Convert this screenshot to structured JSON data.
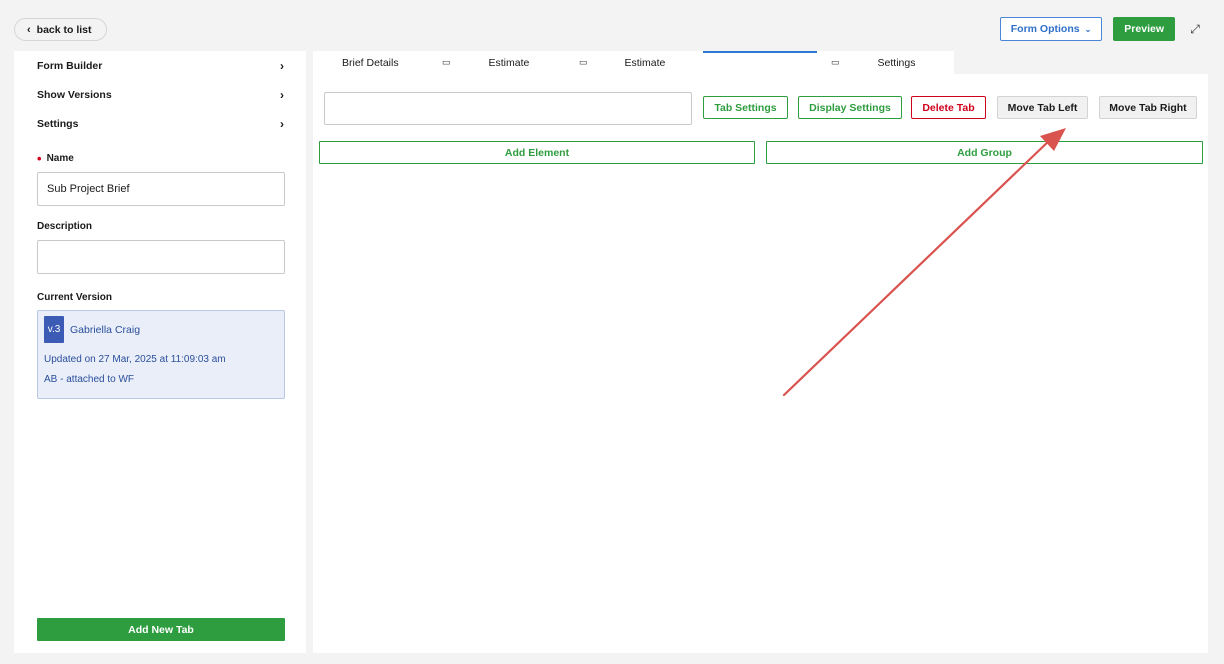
{
  "header": {
    "back_label": "back to list",
    "form_options_label": "Form Options",
    "preview_label": "Preview"
  },
  "sidebar": {
    "menu": [
      {
        "label": "Form Builder"
      },
      {
        "label": "Show Versions"
      },
      {
        "label": "Settings"
      }
    ],
    "name_label": "Name",
    "name_value": "Sub Project Brief",
    "description_label": "Description",
    "description_value": "",
    "current_version_label": "Current Version",
    "version": {
      "badge": "v.3",
      "user": "Gabriella Craig",
      "updated": "Updated on 27 Mar, 2025 at 11:09:03 am",
      "note": "AB - attached to WF"
    },
    "add_tab_label": "Add New Tab"
  },
  "tabs": [
    {
      "label": "Brief Details"
    },
    {
      "label": "Estimate"
    },
    {
      "label": "Estimate"
    },
    {
      "label": ""
    },
    {
      "label": "Settings"
    }
  ],
  "toolbar": {
    "tab_settings_label": "Tab Settings",
    "display_settings_label": "Display Settings",
    "delete_tab_label": "Delete Tab",
    "move_left_label": "Move Tab Left",
    "move_right_label": "Move Tab Right",
    "tab_name_value": ""
  },
  "actions": {
    "add_element_label": "Add Element",
    "add_group_label": "Add Group"
  },
  "colors": {
    "accent_blue": "#2f78d4",
    "success_green": "#2e9d3f",
    "danger_red": "#d0021b",
    "annotation_arrow": "#d9534f"
  },
  "icons": [
    "chevron-left-icon",
    "chevron-down-icon",
    "expand-icon",
    "chevron-right-icon",
    "tab-display-icon"
  ]
}
